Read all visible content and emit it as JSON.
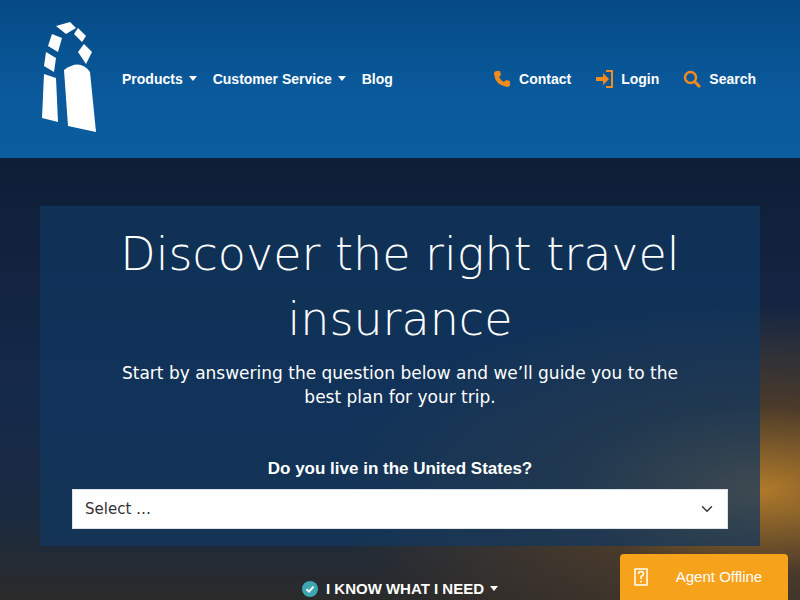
{
  "header": {
    "nav": [
      {
        "label": "Products",
        "dropdown": true
      },
      {
        "label": "Customer Service",
        "dropdown": true
      },
      {
        "label": "Blog",
        "dropdown": false
      }
    ],
    "actions": [
      {
        "label": "Contact",
        "kind": "phone"
      },
      {
        "label": "Login",
        "kind": "login"
      },
      {
        "label": "Search",
        "kind": "search"
      }
    ]
  },
  "hero": {
    "title": "Discover the right travel insurance",
    "subtitle": "Start by answering the question below and we’ll guide you to the best plan for your trip.",
    "question": "Do you live in the United States?",
    "select": {
      "value": "Select …"
    }
  },
  "know_button": {
    "label": "I KNOW WHAT I NEED",
    "dropdown": true
  },
  "chat": {
    "label": "Agent Offline"
  }
}
